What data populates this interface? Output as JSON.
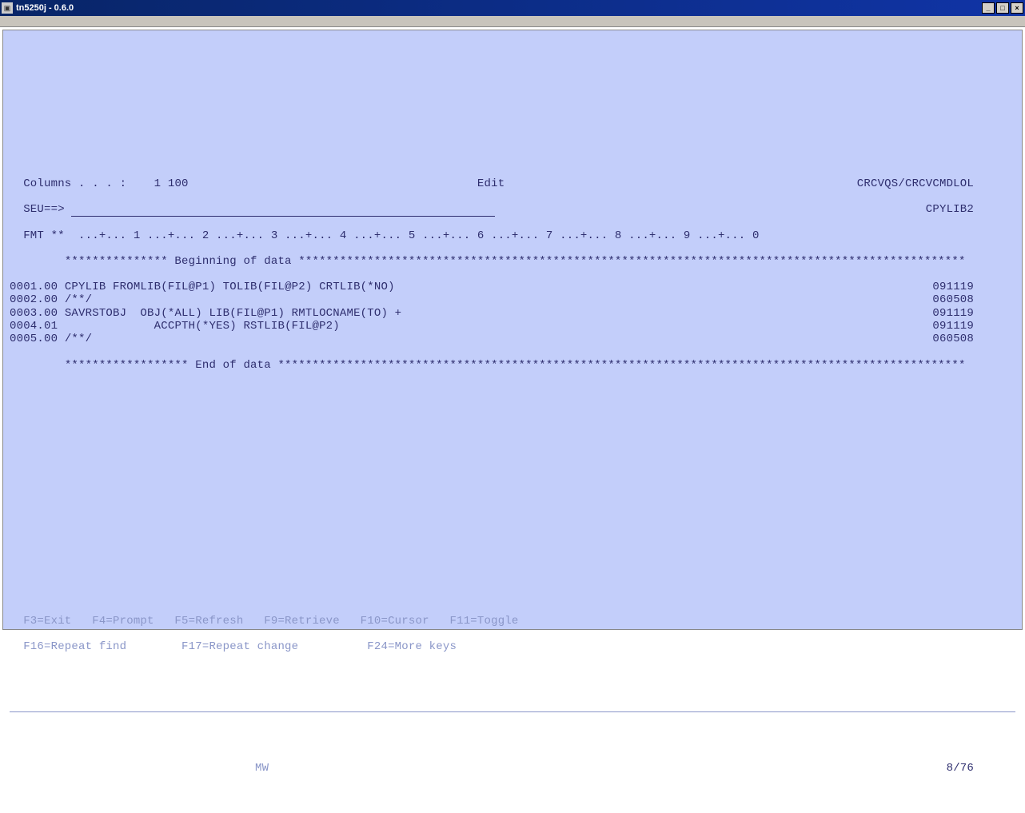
{
  "window": {
    "title": "tn5250j - 0.6.0"
  },
  "header": {
    "columns_label": "Columns . . . :",
    "columns_value": "1 100",
    "mode": "Edit",
    "libmember": "CRCVQS/CRCVCMDLOL",
    "seu_label": "SEU==>",
    "seu_value": "",
    "member": "CPYLIB2",
    "fmt_label": "FMT **",
    "ruler": "  ...+... 1 ...+... 2 ...+... 3 ...+... 4 ...+... 5 ...+... 6 ...+... 7 ...+... 8 ...+... 9 ...+... 0"
  },
  "data": {
    "begin_marker": "*************** Beginning of data *************************************************************************************************",
    "end_marker": "****************** End of data ****************************************************************************************************",
    "lines": [
      {
        "seq": "0001.00",
        "text": "CPYLIB FROMLIB(FIL@P1) TOLIB(FIL@P2) CRTLIB(*NO)",
        "date": "091119"
      },
      {
        "seq": "0002.00",
        "text": "/**/",
        "date": "060508"
      },
      {
        "seq": "0003.00",
        "text": "SAVRSTOBJ  OBJ(*ALL) LIB(FIL@P1) RMTLOCNAME(TO) +",
        "date": "091119"
      },
      {
        "seq": "0004.01",
        "text": "             ACCPTH(*YES) RSTLIB(FIL@P2)",
        "date": "091119"
      },
      {
        "seq": "0005.00",
        "text": "/**/",
        "date": "060508"
      }
    ]
  },
  "fkeys": {
    "row1": "F3=Exit   F4=Prompt   F5=Refresh   F9=Retrieve   F10=Cursor   F11=Toggle",
    "row2": "F16=Repeat find        F17=Repeat change          F24=More keys"
  },
  "status": {
    "indicator": "MW",
    "position": "8/76"
  }
}
